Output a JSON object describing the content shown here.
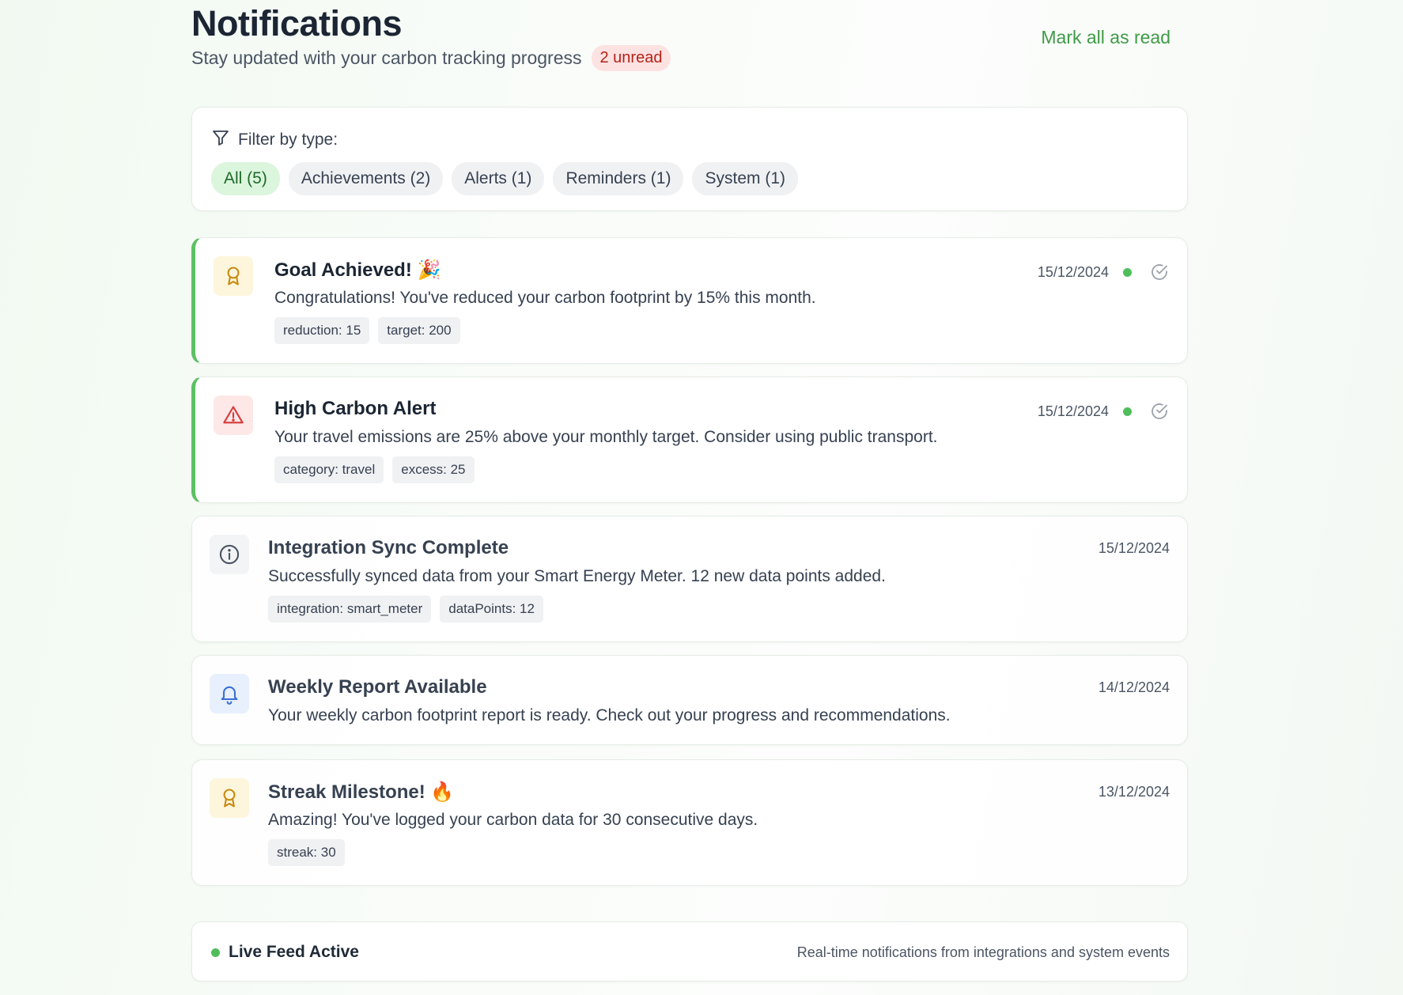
{
  "header": {
    "title": "Notifications",
    "subtitle": "Stay updated with your carbon tracking progress",
    "unread_badge": "2 unread",
    "mark_all": "Mark all as read"
  },
  "filter": {
    "label": "Filter by type:",
    "chips": [
      {
        "label": "All (5)",
        "active": true
      },
      {
        "label": "Achievements (2)",
        "active": false
      },
      {
        "label": "Alerts (1)",
        "active": false
      },
      {
        "label": "Reminders (1)",
        "active": false
      },
      {
        "label": "System (1)",
        "active": false
      }
    ]
  },
  "notifications": [
    {
      "icon": "award-icon",
      "title": "Goal Achieved! 🎉",
      "message": "Congratulations! You've reduced your carbon footprint by 15% this month.",
      "tags": [
        "reduction: 15",
        "target: 200"
      ],
      "date": "15/12/2024",
      "unread": true
    },
    {
      "icon": "alert-triangle-icon",
      "title": "High Carbon Alert",
      "message": "Your travel emissions are 25% above your monthly target. Consider using public transport.",
      "tags": [
        "category: travel",
        "excess: 25"
      ],
      "date": "15/12/2024",
      "unread": true
    },
    {
      "icon": "info-icon",
      "title": "Integration Sync Complete",
      "message": "Successfully synced data from your Smart Energy Meter. 12 new data points added.",
      "tags": [
        "integration: smart_meter",
        "dataPoints: 12"
      ],
      "date": "15/12/2024",
      "unread": false
    },
    {
      "icon": "bell-icon",
      "title": "Weekly Report Available",
      "message": "Your weekly carbon footprint report is ready. Check out your progress and recommendations.",
      "tags": [],
      "date": "14/12/2024",
      "unread": false
    },
    {
      "icon": "award-icon",
      "title": "Streak Milestone! 🔥",
      "message": "Amazing! You've logged your carbon data for 30 consecutive days.",
      "tags": [
        "streak: 30"
      ],
      "date": "13/12/2024",
      "unread": false
    }
  ],
  "live_feed": {
    "label": "Live Feed Active",
    "description": "Real-time notifications from integrations and system events"
  },
  "colors": {
    "accent_green": "#3f9a46",
    "unread_dot": "#4fbe5a",
    "badge_bg": "#fde2e2",
    "badge_text": "#b42318"
  }
}
